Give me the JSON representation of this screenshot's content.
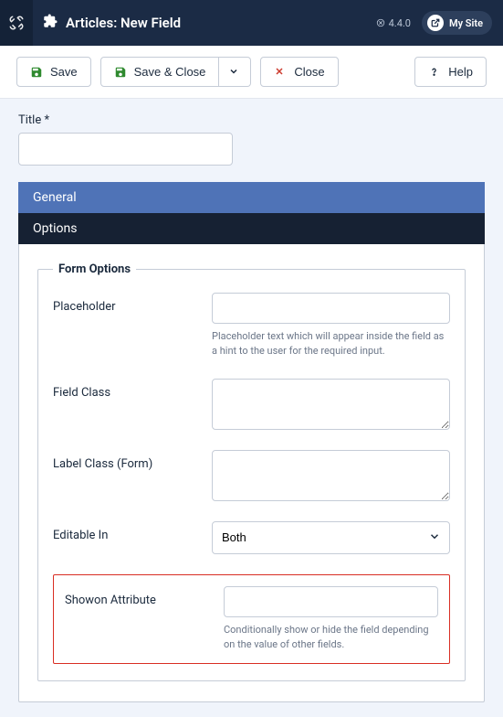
{
  "header": {
    "page_title": "Articles: New Field",
    "version_prefix": "4.4.0",
    "mysite_label": "My Site"
  },
  "toolbar": {
    "save": "Save",
    "save_close": "Save & Close",
    "close": "Close",
    "help": "Help"
  },
  "form": {
    "title_label": "Title *",
    "title_value": ""
  },
  "tabs": {
    "general": "General",
    "options": "Options"
  },
  "form_options": {
    "legend": "Form Options",
    "placeholder": {
      "label": "Placeholder",
      "value": "",
      "help": "Placeholder text which will appear inside the field as a hint to the user for the required input."
    },
    "field_class": {
      "label": "Field Class",
      "value": ""
    },
    "label_class": {
      "label": "Label Class (Form)",
      "value": ""
    },
    "editable_in": {
      "label": "Editable In",
      "selected": "Both"
    },
    "showon": {
      "label": "Showon Attribute",
      "value": "",
      "help": "Conditionally show or hide the field depending on the value of other fields."
    }
  }
}
